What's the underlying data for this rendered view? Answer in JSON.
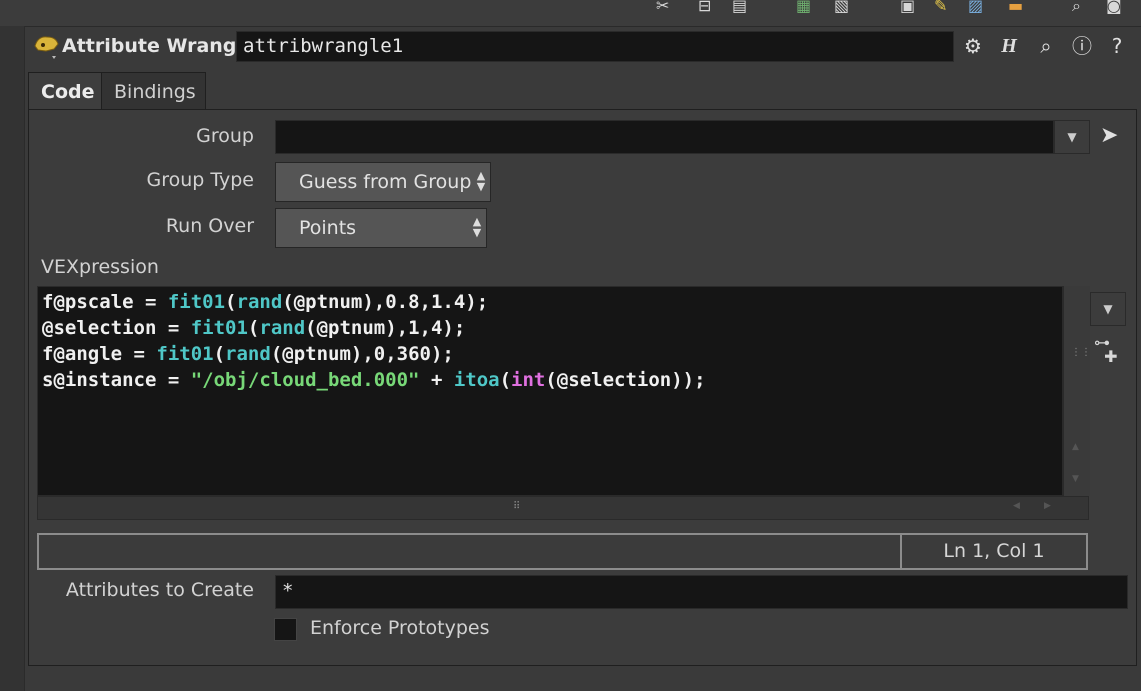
{
  "header": {
    "node_type": "Attribute Wrangle",
    "node_name": "attribwrangle1"
  },
  "tabs": [
    "Code",
    "Bindings"
  ],
  "params": {
    "group_label": "Group",
    "group_value": "",
    "group_type_label": "Group Type",
    "group_type_value": "Guess from Group",
    "run_over_label": "Run Over",
    "run_over_value": "Points",
    "vex_label": "VEXpression",
    "attributes_label": "Attributes to Create",
    "attributes_value": "*",
    "enforce_label": "Enforce Prototypes"
  },
  "code": {
    "l1_a": "f@pscale = ",
    "l1_fn": "fit01",
    "l1_b": "(",
    "l1_fn2": "rand",
    "l1_c": "(@ptnum),0.8,1.4);",
    "l2_a": "@selection = ",
    "l2_fn": "fit01",
    "l2_b": "(",
    "l2_fn2": "rand",
    "l2_c": "(@ptnum),1,4);",
    "l3_a": "f@angle = ",
    "l3_fn": "fit01",
    "l3_b": "(",
    "l3_fn2": "rand",
    "l3_c": "(@ptnum),0,360);",
    "l4_a": "s@instance = ",
    "l4_str": "\"/obj/cloud_bed.000\"",
    "l4_b": " + ",
    "l4_fn": "itoa",
    "l4_c": "(",
    "l4_fn2": "int",
    "l4_d": "(@selection));"
  },
  "status": {
    "position": "Ln 1, Col 1"
  },
  "colors": {
    "function": "#4fc7c7",
    "keyword": "#e070e0",
    "string": "#78d878"
  }
}
